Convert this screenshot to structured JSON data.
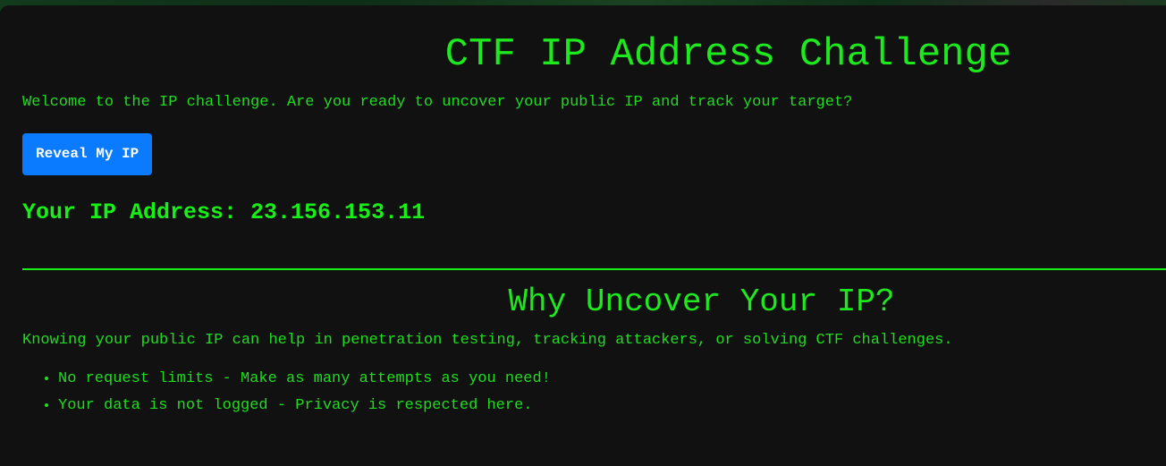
{
  "header": {
    "title": "CTF IP Address Challenge"
  },
  "intro": {
    "text": "Welcome to the IP challenge. Are you ready to uncover your public IP and track your target?"
  },
  "reveal_button": {
    "label": "Reveal My IP"
  },
  "result": {
    "label": "Your IP Address: 23.156.153.11"
  },
  "why_section": {
    "title": "Why Uncover Your IP?",
    "text": "Knowing your public IP can help in penetration testing, tracking attackers, or solving CTF challenges.",
    "features": [
      "No request limits - Make as many attempts as you need!",
      "Your data is not logged - Privacy is respected here."
    ]
  },
  "colors": {
    "background": "#111111",
    "text_green": "#1fdc1f",
    "accent_blue": "#0a7bff"
  }
}
